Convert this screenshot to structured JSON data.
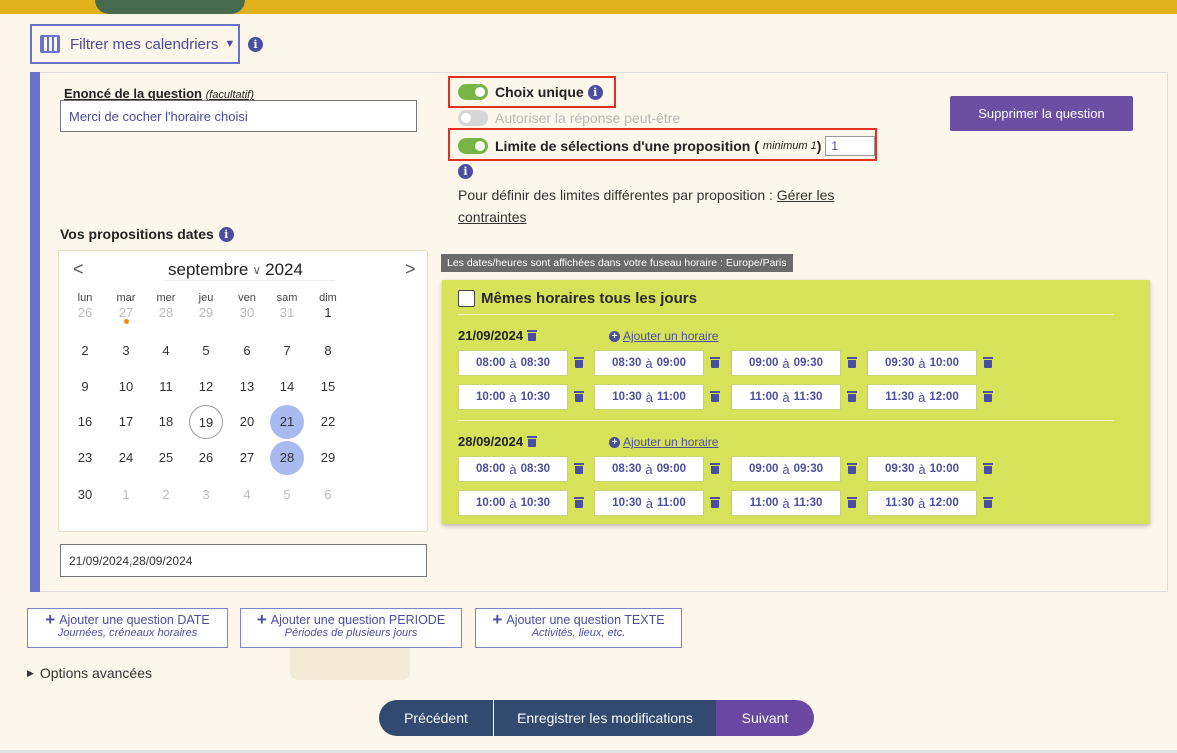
{
  "filter": {
    "label": "Filtrer mes calendriers"
  },
  "question": {
    "enonce_label": "Enoncé de la question",
    "enonce_hint": "(facultatif)",
    "enonce_value": "Merci de cocher l'horaire choisi",
    "choix_unique": "Choix unique",
    "autoriser": "Autoriser la réponse peut-être",
    "limite_label": "Limite de sélections d'une proposition (",
    "limite_hint": "minimum 1",
    "limite_close": ")",
    "limite_value": "1",
    "contraintes_text": "Pour définir des limites différentes par proposition : ",
    "contraintes_link": "Gérer les contraintes",
    "delete_label": "Supprimer la question",
    "colors": {
      "sidebar": "#6a73c9",
      "toggle_on": "#77b646",
      "highlight": "#e03223",
      "delete_bg": "#6c4fa3"
    }
  },
  "propositions": {
    "label": "Vos propositions dates",
    "tz_note": "Les dates/heures sont affichées dans votre fuseau horaire : Europe/Paris",
    "same_hours": "Mêmes horaires tous les jours",
    "dates_value": "21/09/2024,28/09/2024"
  },
  "calendar": {
    "month": "septembre",
    "year": "2024",
    "prev": "<",
    "next": ">",
    "weekdays": [
      "lun",
      "mar",
      "mer",
      "jeu",
      "ven",
      "sam",
      "dim"
    ],
    "weeks": [
      [
        "26",
        "27",
        "28",
        "29",
        "30",
        "31",
        "1"
      ],
      [
        "2",
        "3",
        "4",
        "5",
        "6",
        "7",
        "8"
      ],
      [
        "9",
        "10",
        "11",
        "12",
        "13",
        "14",
        "15"
      ],
      [
        "16",
        "17",
        "18",
        "19",
        "20",
        "21",
        "22"
      ],
      [
        "23",
        "24",
        "25",
        "26",
        "27",
        "28",
        "29"
      ],
      [
        "30",
        "1",
        "2",
        "3",
        "4",
        "5",
        "6"
      ]
    ],
    "today": "19",
    "selected": [
      "21",
      "28"
    ],
    "marked": "27"
  },
  "days": [
    {
      "date": "21/09/2024",
      "add_label": "Ajouter un horaire",
      "slots": [
        [
          "08:00",
          "08:30"
        ],
        [
          "08:30",
          "09:00"
        ],
        [
          "09:00",
          "09:30"
        ],
        [
          "09:30",
          "10:00"
        ],
        [
          "10:00",
          "10:30"
        ],
        [
          "10:30",
          "11:00"
        ],
        [
          "11:00",
          "11:30"
        ],
        [
          "11:30",
          "12:00"
        ]
      ]
    },
    {
      "date": "28/09/2024",
      "add_label": "Ajouter un horaire",
      "slots": [
        [
          "08:00",
          "08:30"
        ],
        [
          "08:30",
          "09:00"
        ],
        [
          "09:00",
          "09:30"
        ],
        [
          "09:30",
          "10:00"
        ],
        [
          "10:00",
          "10:30"
        ],
        [
          "10:30",
          "11:00"
        ],
        [
          "11:00",
          "11:30"
        ],
        [
          "11:30",
          "12:00"
        ]
      ]
    }
  ],
  "slot_sep": "à",
  "add_questions": [
    {
      "title": "Ajouter une question DATE",
      "subtitle": "Journées, créneaux horaires"
    },
    {
      "title": "Ajouter une question PERIODE",
      "subtitle": "Périodes de plusieurs jours"
    },
    {
      "title": "Ajouter une question TEXTE",
      "subtitle": "Activités, lieux, etc."
    }
  ],
  "advanced": "Options avancées",
  "nav": {
    "prev": "Précédent",
    "save": "Enregistrer les modifications",
    "next": "Suivant"
  }
}
